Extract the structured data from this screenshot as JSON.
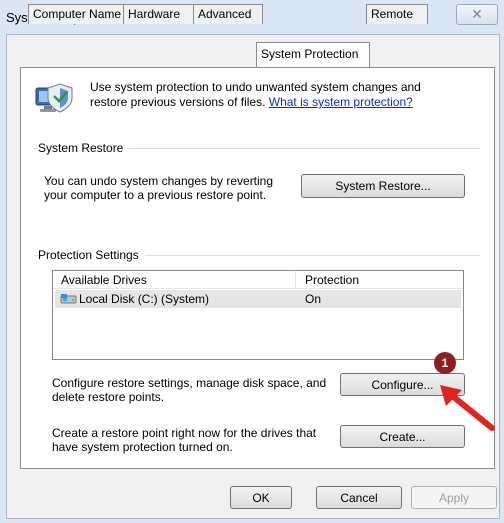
{
  "window": {
    "title": "System Properties",
    "close_glyph": "✕"
  },
  "tabs": [
    {
      "label": "Computer Name"
    },
    {
      "label": "Hardware"
    },
    {
      "label": "Advanced"
    },
    {
      "label": "System Protection"
    },
    {
      "label": "Remote"
    }
  ],
  "intro": {
    "line1": "Use system protection to undo unwanted system changes and",
    "line2_prefix": "restore previous versions of files. ",
    "link": "What is system protection?",
    "icon": "shield-monitor-icon"
  },
  "system_restore": {
    "group_label": "System Restore",
    "line1": "You can undo system changes by reverting",
    "line2": "your computer to a previous restore point.",
    "button": "System Restore..."
  },
  "protection": {
    "group_label": "Protection Settings",
    "columns": [
      "Available Drives",
      "Protection"
    ],
    "rows": [
      {
        "drive": "Local Disk (C:) (System)",
        "protection": "On",
        "icon": "drive-icon"
      }
    ],
    "configure_line1": "Configure restore settings, manage disk space, and",
    "configure_line2": "delete restore points.",
    "configure_button": "Configure...",
    "create_line1": "Create a restore point right now for the drives that",
    "create_line2": "have system protection turned on.",
    "create_button": "Create..."
  },
  "annotation": {
    "badge": "1",
    "arrow_color": "#e02424"
  },
  "footer": {
    "ok": "OK",
    "cancel": "Cancel",
    "apply": "Apply"
  }
}
